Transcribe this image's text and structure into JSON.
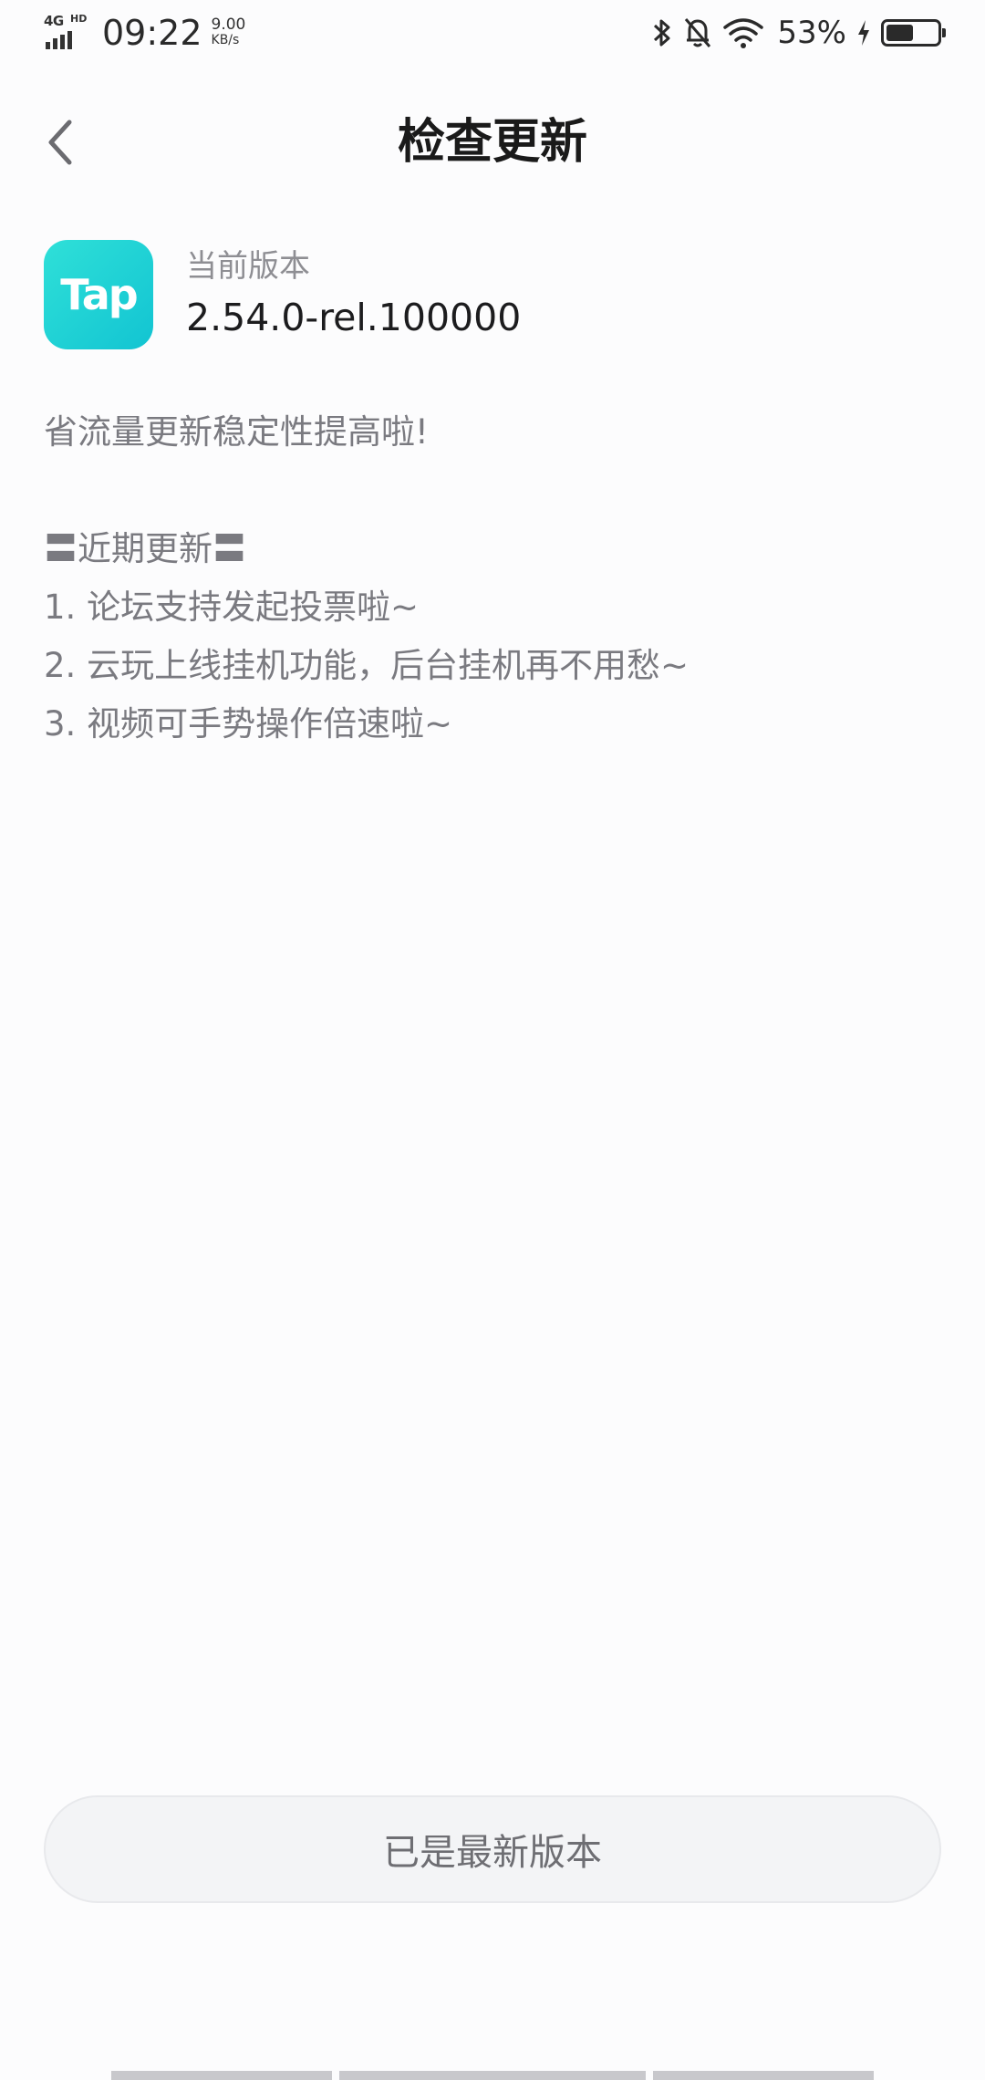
{
  "status_bar": {
    "network": "4G",
    "network_sup": "HD",
    "time": "09:22",
    "speed_value": "9.00",
    "speed_unit": "KB/s",
    "battery_percent": "53%",
    "battery_level": 0.53,
    "icons": [
      "bluetooth-icon",
      "bell-off-icon",
      "wifi-icon",
      "charging-icon",
      "battery-icon"
    ]
  },
  "header": {
    "title": "检查更新",
    "back_icon": "chevron-left-icon"
  },
  "app": {
    "logo_text": "Tap",
    "version_label": "当前版本",
    "version_value": "2.54.0-rel.100000"
  },
  "release_notes": {
    "intro": "省流量更新稳定性提高啦!",
    "section_title": "〓近期更新〓",
    "items": [
      "1. 论坛支持发起投票啦~",
      "2. 云玩上线挂机功能，后台挂机再不用愁~",
      "3. 视频可手势操作倍速啦~"
    ]
  },
  "footer": {
    "button_label": "已是最新版本"
  },
  "colors": {
    "accent": "#12c4d2",
    "background": "#fcfcfd",
    "muted_text": "#7a7a80"
  }
}
